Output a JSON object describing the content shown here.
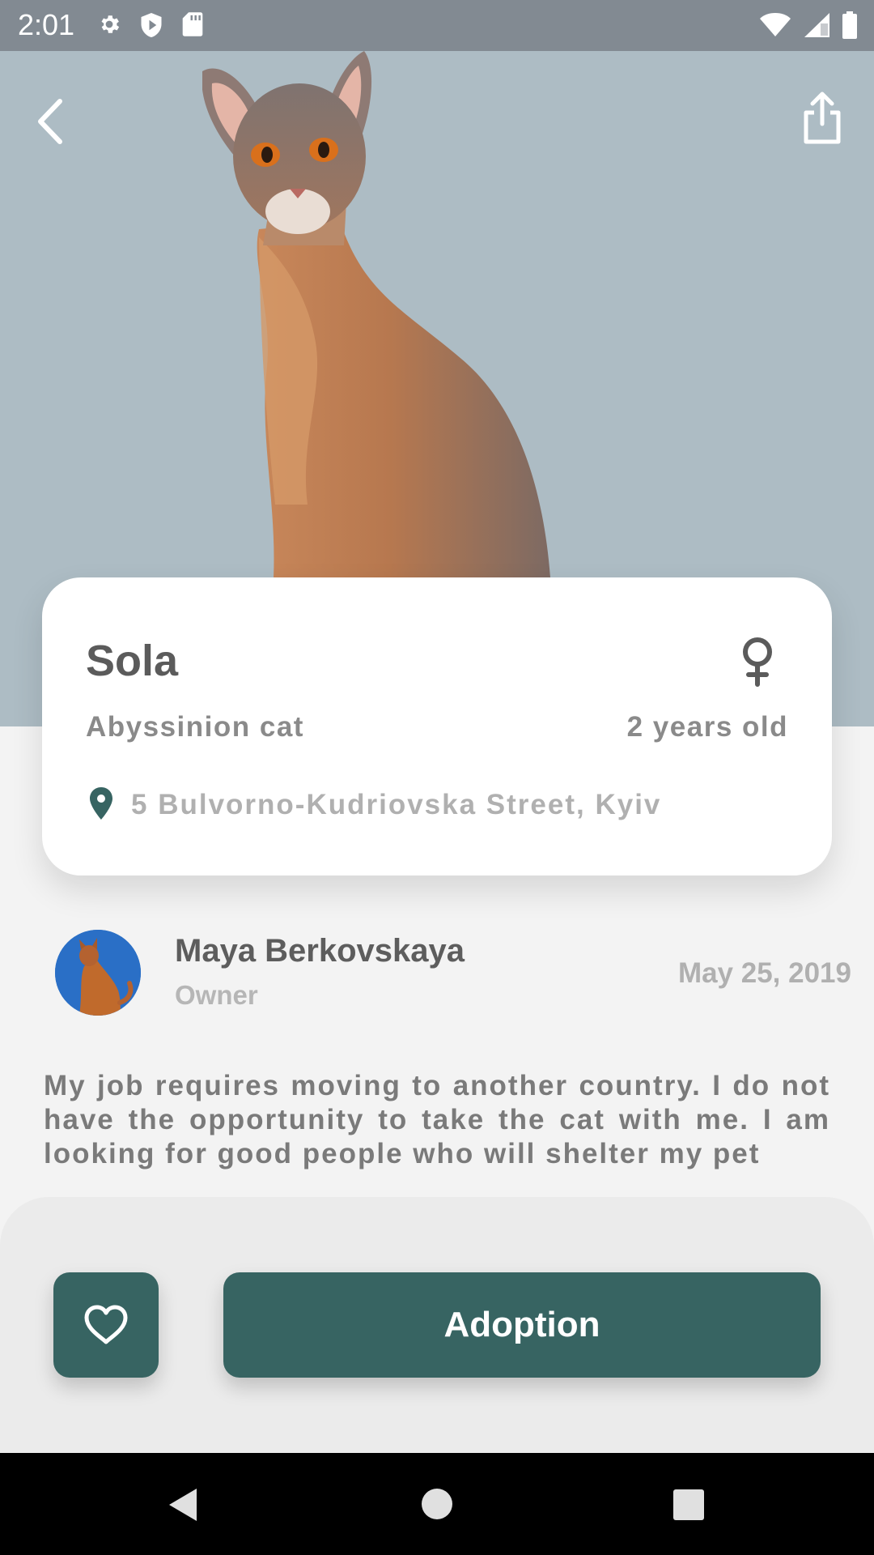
{
  "status_bar": {
    "time": "2:01",
    "left_icons": [
      "gear-icon",
      "shield-icon",
      "sd-card-icon"
    ],
    "right_icons": [
      "wifi-icon",
      "signal-icon",
      "battery-icon"
    ]
  },
  "hero": {
    "background_color": "#adbcc4",
    "back_icon": "chevron-left-icon",
    "share_icon": "share-icon"
  },
  "pet": {
    "name": "Sola",
    "gender_icon": "female-icon",
    "breed": "Abyssinion cat",
    "age": "2 years old",
    "location_icon": "location-pin-icon",
    "address": "5 Bulvorno-Kudriovska Street, Kyiv"
  },
  "owner": {
    "name": "Maya Berkovskaya",
    "role": "Owner",
    "date": "May 25, 2019"
  },
  "description": "My job requires moving to another country. I do not have the opportunity to take the cat with me. I am looking for good people who will shelter my pet",
  "actions": {
    "favorite_icon": "heart-icon",
    "adopt_label": "Adoption",
    "accent_color": "#376462"
  },
  "nav_bar": {
    "icons": [
      "nav-back-icon",
      "nav-home-icon",
      "nav-recents-icon"
    ]
  }
}
